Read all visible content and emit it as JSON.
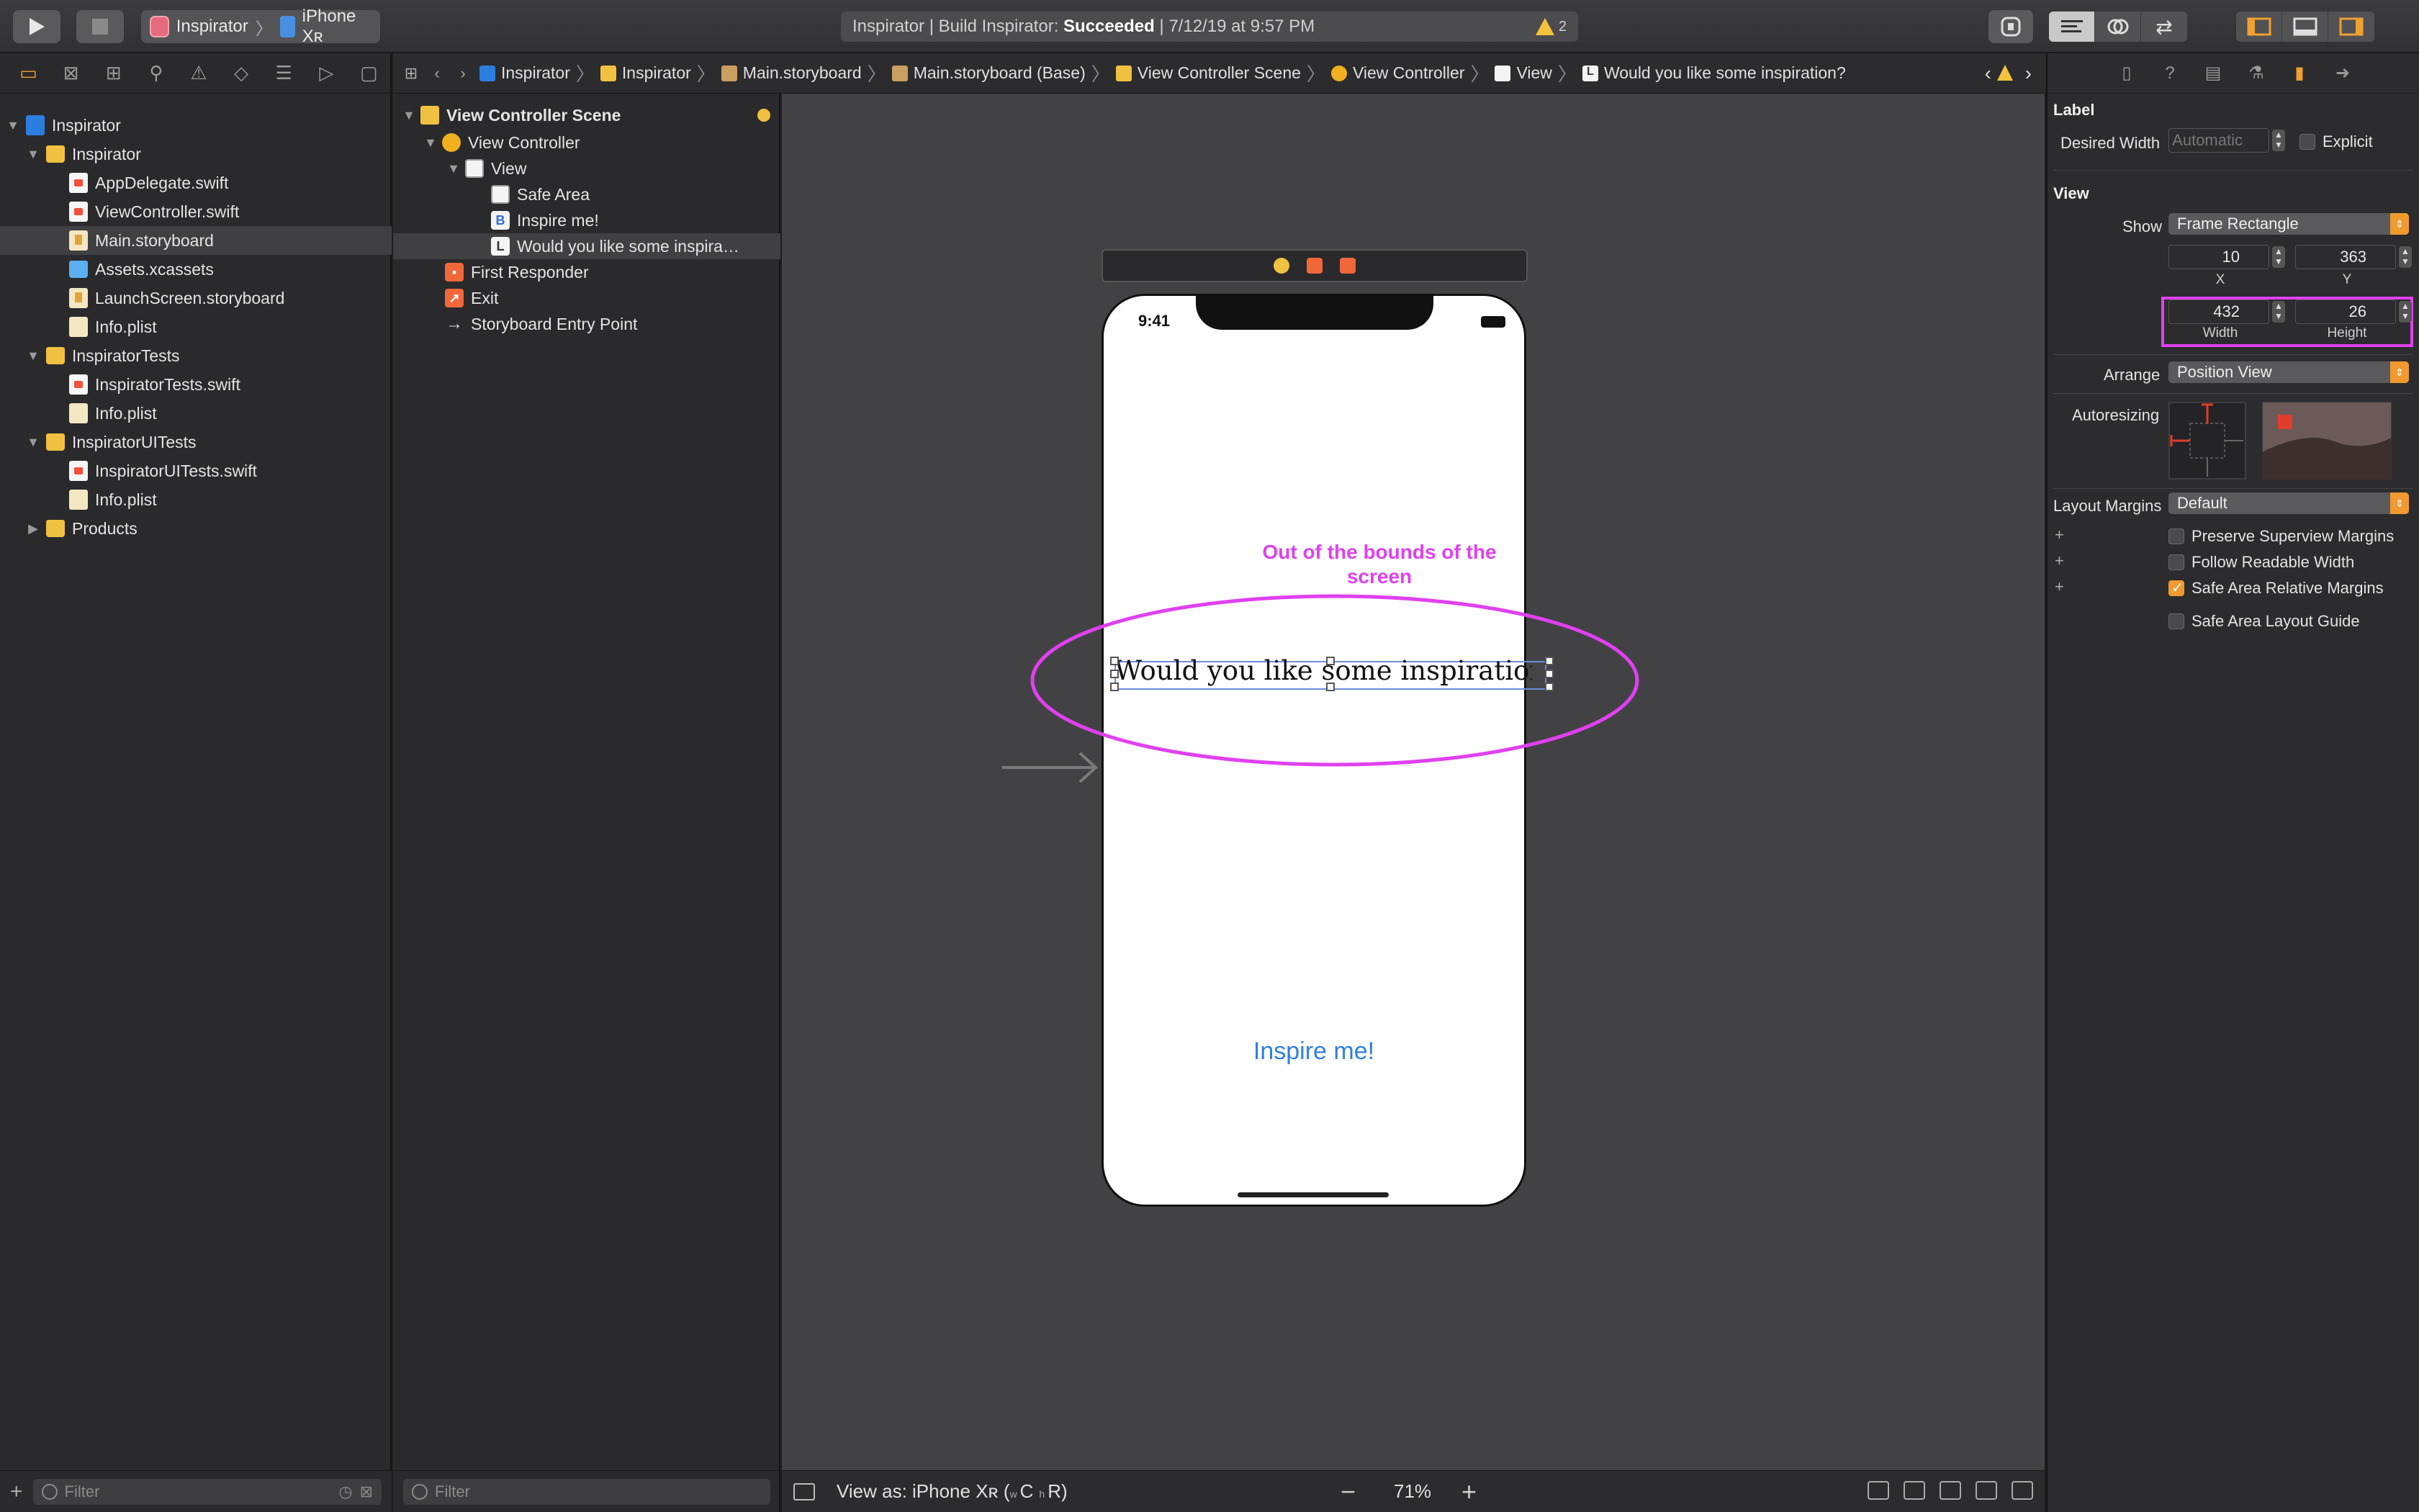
{
  "toolbar": {
    "scheme_name": "Inspirator",
    "device_name": "iPhone Xʀ",
    "activity_text": "Inspirator | Build Inspirator: ",
    "activity_status": "Succeeded",
    "activity_time": " | 7/12/19 at 9:57 PM",
    "warning_count": "2"
  },
  "navigator": {
    "items": [
      {
        "label": "Inspirator",
        "kind": "project"
      },
      {
        "label": "Inspirator",
        "kind": "folder"
      },
      {
        "label": "AppDelegate.swift",
        "kind": "swift"
      },
      {
        "label": "ViewController.swift",
        "kind": "swift"
      },
      {
        "label": "Main.storyboard",
        "kind": "storyboard",
        "selected": true
      },
      {
        "label": "Assets.xcassets",
        "kind": "assets"
      },
      {
        "label": "LaunchScreen.storyboard",
        "kind": "storyboard"
      },
      {
        "label": "Info.plist",
        "kind": "plist"
      },
      {
        "label": "InspiratorTests",
        "kind": "folder"
      },
      {
        "label": "InspiratorTests.swift",
        "kind": "swift"
      },
      {
        "label": "Info.plist",
        "kind": "plist"
      },
      {
        "label": "InspiratorUITests",
        "kind": "folder"
      },
      {
        "label": "InspiratorUITests.swift",
        "kind": "swift"
      },
      {
        "label": "Info.plist",
        "kind": "plist"
      },
      {
        "label": "Products",
        "kind": "folder"
      }
    ],
    "filter_placeholder": "Filter"
  },
  "jumpbar": {
    "crumbs": [
      "Inspirator",
      "Inspirator",
      "Main.storyboard",
      "Main.storyboard (Base)",
      "View Controller Scene",
      "View Controller",
      "View",
      "Would you like some inspiration?"
    ]
  },
  "outline": {
    "items": [
      {
        "label": "View Controller Scene"
      },
      {
        "label": "View Controller"
      },
      {
        "label": "View"
      },
      {
        "label": "Safe Area"
      },
      {
        "label": "Inspire me!"
      },
      {
        "label": "Would you like some inspira…"
      },
      {
        "label": "First Responder"
      },
      {
        "label": "Exit"
      },
      {
        "label": "Storyboard Entry Point"
      }
    ],
    "filter_placeholder": "Filter"
  },
  "canvas": {
    "status_time": "9:41",
    "label_text": "Would you like some inspiration?",
    "button_text": "Inspire me!",
    "annotation": "Out of the bounds of the screen",
    "annotation_color": "#e040f0",
    "view_as": "View as: iPhone Xʀ (",
    "size_class_w": "w",
    "size_class_C": "C",
    "size_class_h": "h",
    "size_class_R": "R)",
    "zoom": "71%"
  },
  "inspector": {
    "label_section": "Label",
    "desired_width_label": "Desired Width",
    "desired_width_value": "Automatic",
    "explicit_label": "Explicit",
    "view_section": "View",
    "show_label": "Show",
    "show_value": "Frame Rectangle",
    "x_value": "10",
    "y_value": "363",
    "x_label": "X",
    "y_label": "Y",
    "width_value": "432",
    "height_value": "26",
    "width_label": "Width",
    "height_label": "Height",
    "arrange_label": "Arrange",
    "arrange_value": "Position View",
    "autoresizing_label": "Autoresizing",
    "layout_margins_label": "Layout Margins",
    "layout_margins_value": "Default",
    "preserve_label": "Preserve Superview Margins",
    "readable_label": "Follow Readable Width",
    "safe_relative_label": "Safe Area Relative Margins",
    "safe_guide_label": "Safe Area Layout Guide",
    "safe_relative_checked": true
  }
}
